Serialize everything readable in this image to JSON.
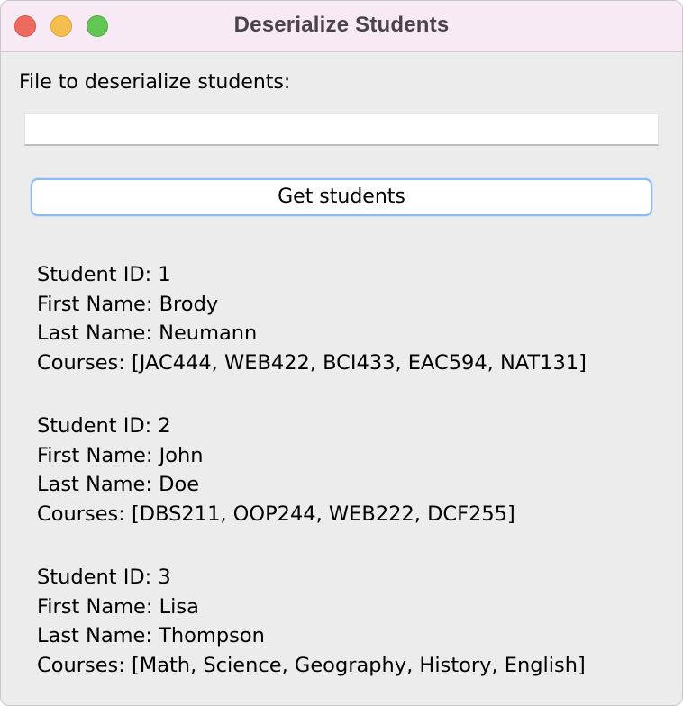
{
  "window": {
    "title": "Deserialize Students"
  },
  "form": {
    "file_label": "File to deserialize students:",
    "file_value": "",
    "file_placeholder": "",
    "get_button_label": "Get students"
  },
  "students": [
    {
      "id_line": "Student ID: 1",
      "first_line": "First Name: Brody",
      "last_line": "Last Name: Neumann",
      "courses_line": "Courses: [JAC444, WEB422, BCI433, EAC594, NAT131]"
    },
    {
      "id_line": "Student ID: 2",
      "first_line": "First Name: John",
      "last_line": "Last Name: Doe",
      "courses_line": "Courses: [DBS211, OOP244, WEB222, DCF255]"
    },
    {
      "id_line": "Student ID: 3",
      "first_line": "First Name: Lisa",
      "last_line": "Last Name: Thompson",
      "courses_line": "Courses: [Math, Science, Geography, History, English]"
    }
  ],
  "colors": {
    "titlebar": "#f7eaf5",
    "window_bg": "#ececec",
    "close": "#ed6a5e",
    "minimize": "#f5bf4f",
    "maximize": "#62c655",
    "button_focus_ring": "#8fbaf0"
  }
}
